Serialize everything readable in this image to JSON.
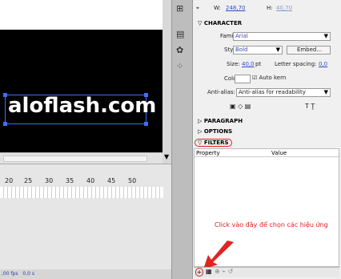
{
  "properties": {
    "w_label": "W:",
    "w_value": "248,70",
    "h_label": "H:",
    "h_value": "40,70",
    "character_header": "CHARACTER",
    "family_label": "Family:",
    "family_value": "Arial",
    "style_label": "Style:",
    "style_value": "Bold",
    "embed_button": "Embed...",
    "size_label": "Size:",
    "size_value": "40,0",
    "size_unit": "pt",
    "letter_spacing_label": "Letter spacing:",
    "letter_spacing_value": "0,0",
    "color_label": "Color:",
    "auto_kern_label": "Auto kern",
    "antialias_label": "Anti-alias:",
    "antialias_value": "Anti-alias for readability",
    "paragraph_header": "PARAGRAPH",
    "options_header": "OPTIONS",
    "filters_header": "FILTERS",
    "col_property": "Property",
    "col_value": "Value"
  },
  "stage": {
    "text": "aloflash.com"
  },
  "timeline": {
    "ruler_labels": [
      "20",
      "25",
      "30",
      "35",
      "40",
      "45",
      "50"
    ],
    "status_fps": ",00 fps",
    "status_time": "0,0 s"
  },
  "annotation": {
    "text": "Click vào đây để chọn các hiệu ứng"
  },
  "icons": {
    "arrow": "red-arrow-icon"
  },
  "colors": {
    "annotation": "#e02020",
    "link": "#2c4dc9",
    "stage_bg": "#000000",
    "selection": "#3a6fff"
  }
}
